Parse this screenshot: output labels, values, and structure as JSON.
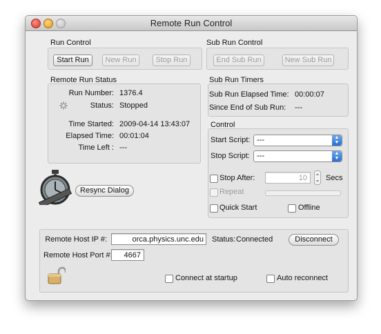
{
  "window": {
    "title": "Remote Run Control"
  },
  "run_control": {
    "heading": "Run Control",
    "start_label": "Start Run",
    "new_label": "New Run",
    "stop_label": "Stop Run"
  },
  "sub_run_control": {
    "heading": "Sub Run Control",
    "end_label": "End Sub Run",
    "new_label": "New Sub Run"
  },
  "status": {
    "heading": "Remote Run Status",
    "run_number_label": "Run Number:",
    "run_number": "1376.4",
    "status_label": "Status:",
    "status": "Stopped",
    "time_started_label": "Time Started:",
    "time_started": "2009-04-14 13:43:07",
    "elapsed_label": "Elapsed Time:",
    "elapsed": "00:01:04",
    "time_left_label": "Time Left :",
    "time_left": "---"
  },
  "timers": {
    "heading": "Sub Run Timers",
    "elapsed_label": "Sub Run Elapsed Time:",
    "elapsed": "00:00:07",
    "since_end_label": "Since End of Sub Run:",
    "since_end": "---"
  },
  "control": {
    "heading": "Control",
    "start_script_label": "Start Script:",
    "start_script_value": "---",
    "stop_script_label": "Stop Script:",
    "stop_script_value": "---",
    "stop_after_label": "Stop After:",
    "stop_after_value": "10",
    "secs_label": "Secs",
    "repeat_label": "Repeat",
    "quick_start_label": "Quick Start",
    "offline_label": "Offline"
  },
  "resync_label": "Resync Dialog",
  "connection": {
    "ip_label": "Remote Host IP #:",
    "ip_value": "orca.physics.unc.edu",
    "status_label": "Status:",
    "status_value": "Connected",
    "disconnect_label": "Disconnect",
    "port_label": "Remote Host Port #:",
    "port_value": "4667",
    "connect_startup_label": "Connect at startup",
    "auto_reconnect_label": "Auto reconnect"
  },
  "icons": [
    "close-icon",
    "minimize-icon",
    "zoom-icon",
    "spinner-icon",
    "stopwatch-icon",
    "lock-icon",
    "stepper-icon",
    "popup-arrow-icon"
  ]
}
